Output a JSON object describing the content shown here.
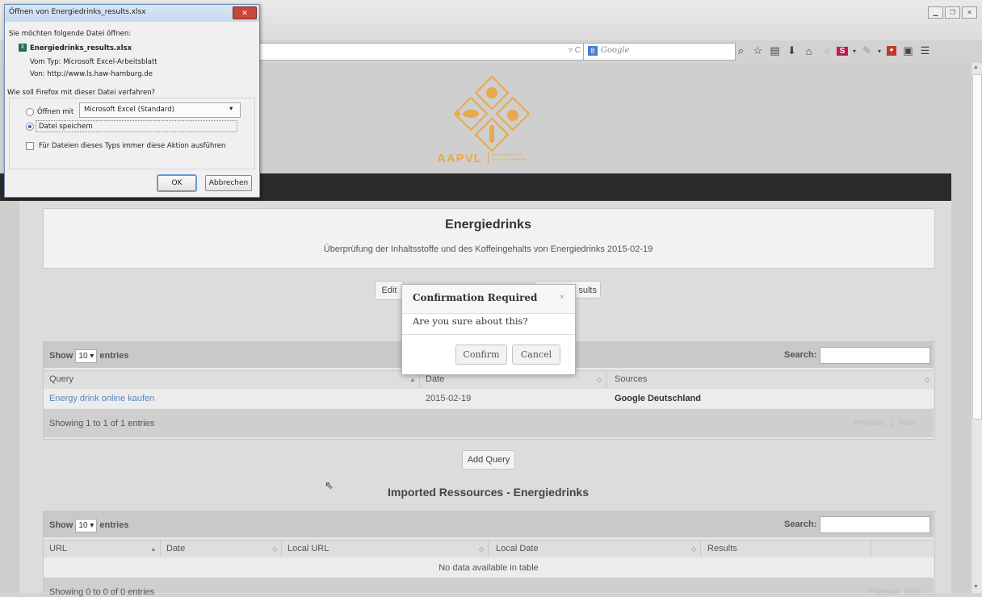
{
  "browser": {
    "search_placeholder": "Google",
    "search_engine_badge": "8"
  },
  "logo": {
    "name": "AAPVL",
    "tagline_line1": "AUTOMATISIERTES",
    "tagline_line2": "ANALYSEVERFAHREN",
    "accent": "#e8a94a"
  },
  "project": {
    "title": "Energiedrinks",
    "subtitle": "Überprüfung der Inhaltsstoffe und des Koffeingehalts von Energiedrinks 2015-02-19"
  },
  "actions": {
    "edit_label": "Edit",
    "results_label": "sults"
  },
  "queries_table": {
    "show_label": "Show",
    "entries_value": "10",
    "entries_label": "entries",
    "search_label": "Search:",
    "columns": [
      "Query",
      "Date",
      "Sources"
    ],
    "rows": [
      {
        "query": "Energy drink online kaufen",
        "date": "2015-02-19",
        "sources": "Google Deutschland"
      }
    ],
    "info": "Showing 1 to 1 of 1 entries",
    "pager_prev": "Previous",
    "pager_page": "1",
    "pager_next": "Next"
  },
  "add_query_label": "Add Query",
  "imported": {
    "heading": "Imported Ressources - Energiedrinks",
    "show_label": "Show",
    "entries_value": "10",
    "entries_label": "entries",
    "search_label": "Search:",
    "columns": [
      "URL",
      "Date",
      "Local URL",
      "Local Date",
      "Results"
    ],
    "empty_text": "No data available in table",
    "info": "Showing 0 to 0 of 0 entries",
    "pager_prev": "Previous",
    "pager_next": "Next"
  },
  "modal": {
    "title": "Confirmation Required",
    "close": "×",
    "message": "Are you sure about this?",
    "confirm_label": "Confirm",
    "cancel_label": "Cancel"
  },
  "download_dialog": {
    "title": "Öffnen von Energiedrinks_results.xlsx",
    "intro": "Sie möchten folgende Datei öffnen:",
    "filename": "Energiedrinks_results.xlsx",
    "type_line": "Vom Typ: Microsoft Excel-Arbeitsblatt",
    "from_line": "Von: http://www.ls.haw-hamburg.de",
    "question": "Wie soll Firefox mit dieser Datei verfahren?",
    "open_with_label": "Öffnen mit",
    "open_with_app": "Microsoft Excel (Standard)",
    "save_label": "Datei speichern",
    "always_label": "Für Dateien dieses Typs immer diese Aktion ausführen",
    "ok_label": "OK",
    "cancel_label": "Abbrechen",
    "close": "✕"
  }
}
